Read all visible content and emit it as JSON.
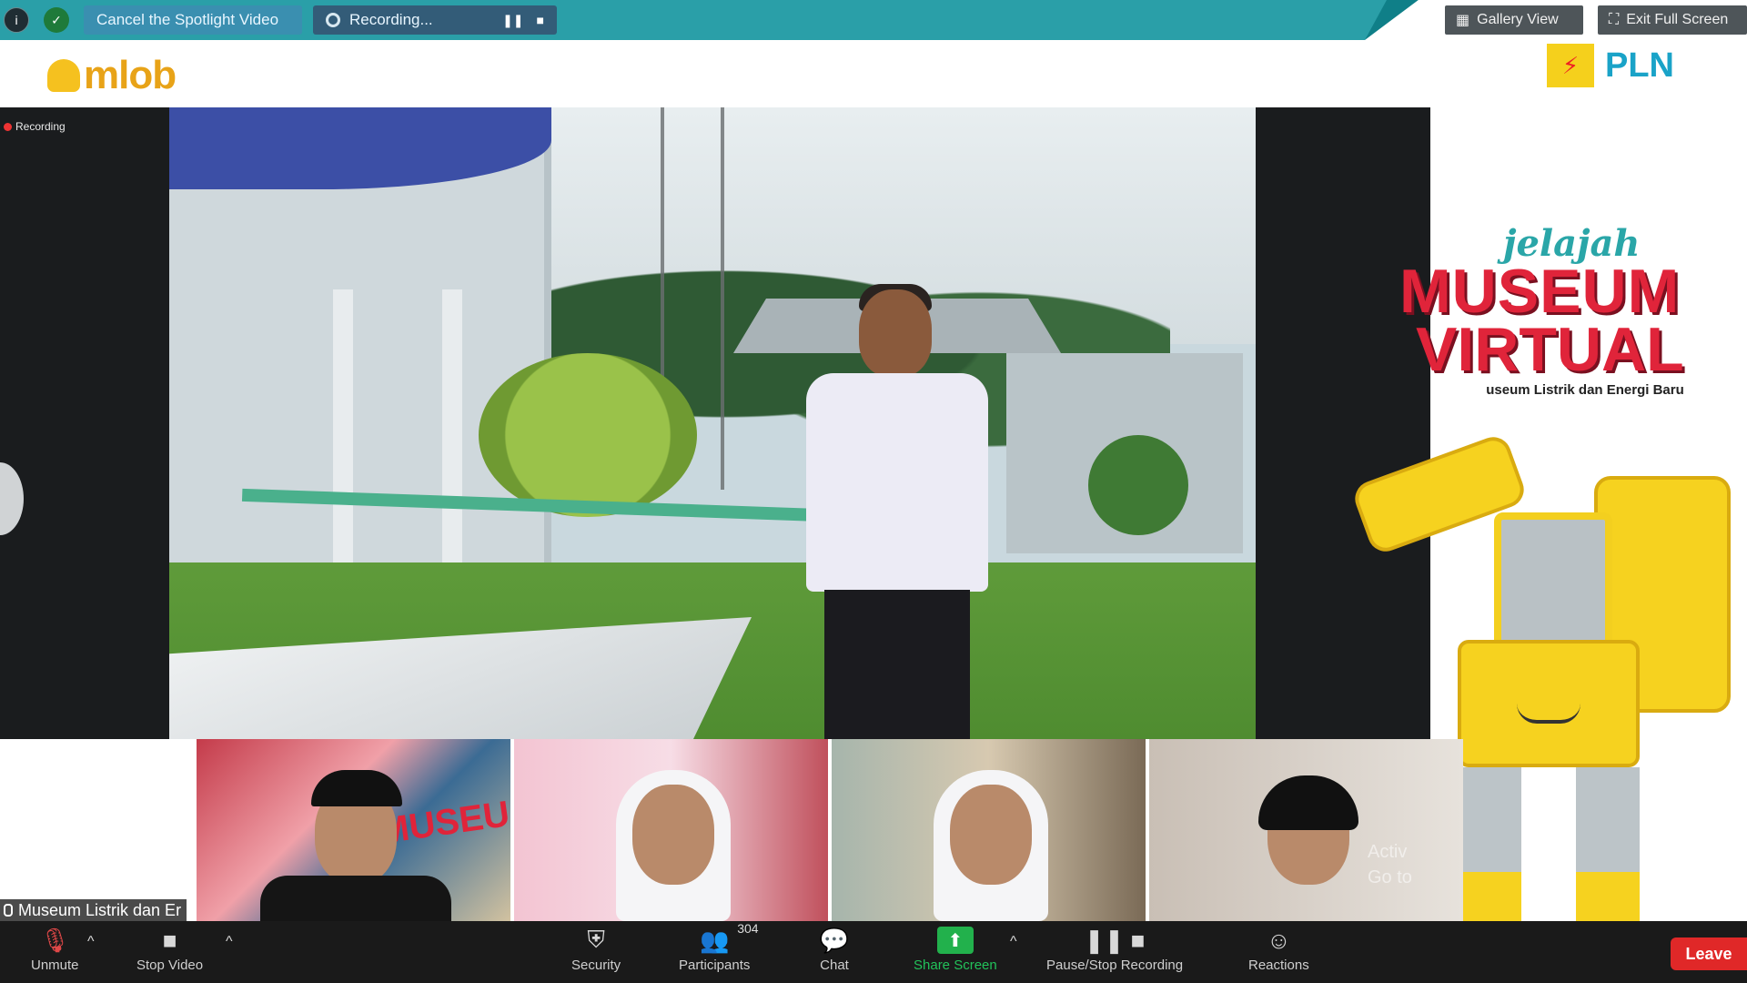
{
  "topbar": {
    "cancel_spotlight": "Cancel the Spotlight Video",
    "recording": "Recording...",
    "gallery_view": "Gallery View",
    "exit_full_screen": "Exit Full Screen"
  },
  "logos": {
    "left": "mlob",
    "right": "PLN"
  },
  "stage": {
    "recording_indicator": "Recording"
  },
  "poster": {
    "jelajah": "jelajah",
    "museum": "MUSEUM",
    "virtual": "VIRTUAL",
    "subtitle": "useum Listrik dan Energi Baru"
  },
  "thumbnails": {
    "t1_overlay": "MUSEU",
    "t4_watermark_1": "Activ",
    "t4_watermark_2": "Go to"
  },
  "name_tag": "Museum Listrik dan Er",
  "toolbar": {
    "unmute": "Unmute",
    "stop_video": "Stop Video",
    "security": "Security",
    "participants": "Participants",
    "participants_count": "304",
    "chat": "Chat",
    "share_screen": "Share Screen",
    "pause_stop_recording": "Pause/Stop Recording",
    "reactions": "Reactions",
    "leave": "Leave"
  },
  "colors": {
    "topbar_accent": "#2a9fa8",
    "share_green": "#22b14c",
    "leave_red": "#e02828",
    "poster_red": "#e0243a"
  }
}
